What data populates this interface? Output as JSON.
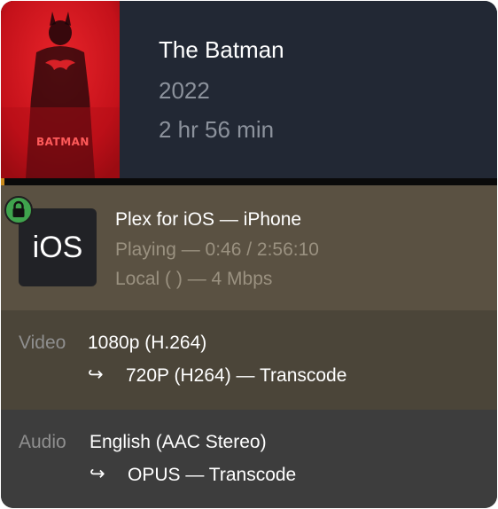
{
  "media": {
    "title": "The Batman",
    "year": "2022",
    "duration": "2 hr 56 min",
    "poster_text": "BATMAN"
  },
  "progress": {
    "fraction": 0.004,
    "color": "#c98a1c"
  },
  "player": {
    "icon_label": "iOS",
    "icon_name": "ios-app-icon",
    "lock_icon": "lock-icon",
    "name": "Plex for iOS  —  iPhone",
    "state": "Playing  —  0:46 / 2:56:10",
    "network": "Local (                              )  —  4 Mbps"
  },
  "video": {
    "label": "Video",
    "source": "1080p (H.264)",
    "arrow": "↪",
    "target": "720P (H264)  —  Transcode"
  },
  "audio": {
    "label": "Audio",
    "source": "English (AAC Stereo)",
    "arrow": "↪",
    "target": "OPUS  —  Transcode"
  },
  "colors": {
    "header_bg": "#222834",
    "player_bg": "#5a5142",
    "video_bg": "#4b4539",
    "audio_bg": "#3d3d3d",
    "lock_green": "#3fa34d",
    "poster_red": "#d2111a"
  }
}
